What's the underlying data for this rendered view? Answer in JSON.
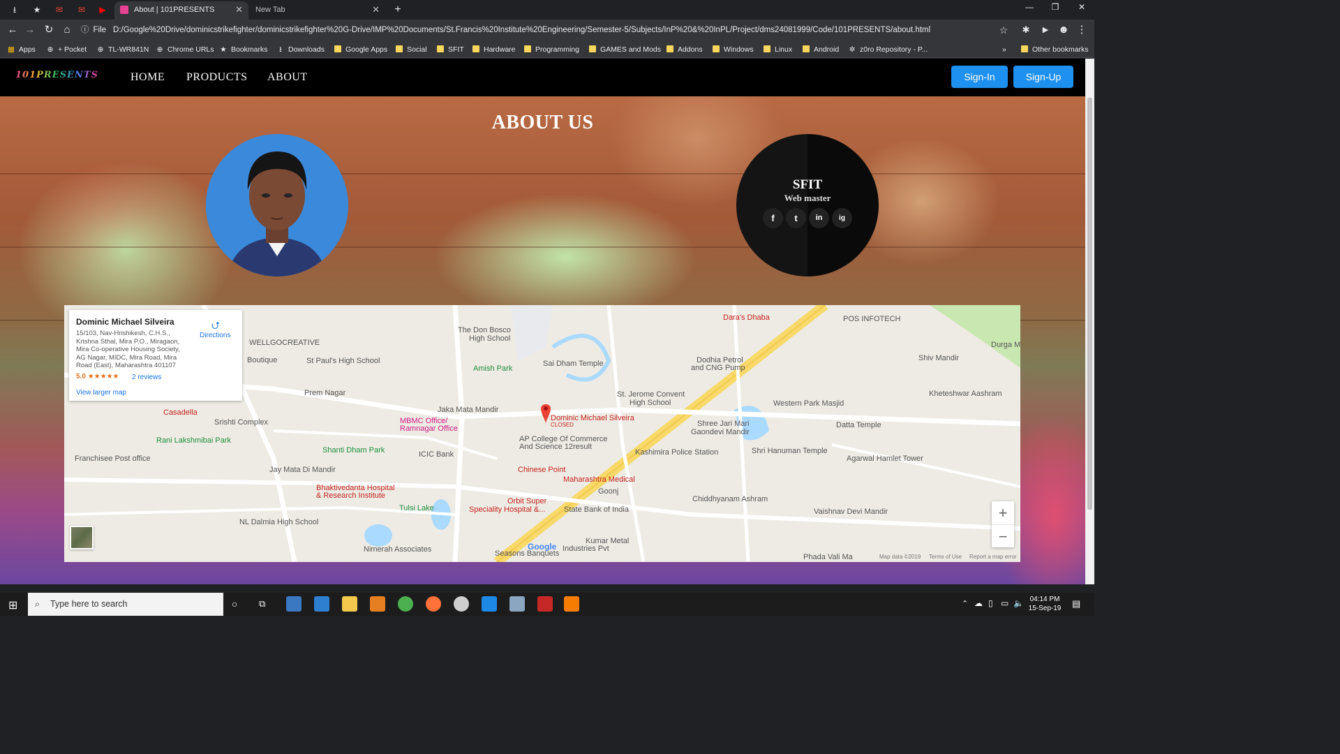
{
  "browser": {
    "tabs": [
      {
        "title": "About | 101PRESENTS",
        "active": true
      },
      {
        "title": "New Tab",
        "active": false
      }
    ],
    "address": {
      "scheme_label": "File",
      "url": "D:/Google%20Drive/dominicstrikefighter/dominicstrikefighter%20G-Drive/IMP%20Documents/St.Francis%20Institute%20Engineering/Semester-5/Subjects/InP%20&%20InPL/Project/dms24081999/Code/101PRESENTS/about.html"
    },
    "bookmarks": [
      {
        "label": "Apps",
        "icon": "apps-grid-icon"
      },
      {
        "label": "+ Pocket",
        "icon": "globe-icon"
      },
      {
        "label": "TL-WR841N",
        "icon": "globe-icon"
      },
      {
        "label": "Chrome URLs",
        "icon": "globe-icon"
      },
      {
        "label": "Bookmarks",
        "icon": "star-icon"
      },
      {
        "label": "Downloads",
        "icon": "download-icon"
      },
      {
        "label": "Google Apps",
        "icon": "folder-icon"
      },
      {
        "label": "Social",
        "icon": "folder-icon"
      },
      {
        "label": "SFIT",
        "icon": "folder-icon"
      },
      {
        "label": "Hardware",
        "icon": "folder-icon"
      },
      {
        "label": "Programming",
        "icon": "folder-icon"
      },
      {
        "label": "GAMES and Mods",
        "icon": "folder-icon"
      },
      {
        "label": "Addons",
        "icon": "folder-icon"
      },
      {
        "label": "Windows",
        "icon": "folder-icon"
      },
      {
        "label": "Linux",
        "icon": "folder-icon"
      },
      {
        "label": "Android",
        "icon": "folder-icon"
      },
      {
        "label": "z0ro Repository - P...",
        "icon": "bug-icon"
      }
    ],
    "other_bookmarks": "Other bookmarks"
  },
  "site": {
    "logo_text": "101PRESENTS",
    "nav": {
      "home": "HOME",
      "products": "PRODUCTS",
      "about": "ABOUT"
    },
    "auth": {
      "signin": "Sign-In",
      "signup": "Sign-Up"
    },
    "heading": "ABOUT US",
    "card": {
      "org": "SFIT",
      "role": "Web master",
      "social": [
        "f",
        "t",
        "in",
        "ig"
      ]
    }
  },
  "map": {
    "info": {
      "name": "Dominic Michael Silveira",
      "address": "15/103, Nav-Hrishikesh, C.H.S., Krishna Sthal, Mira P.O., Miragaon, Mira Co-operative Housing Society, AG Nagar, MIDC, Mira Road, Mira Road (East), Maharashtra 401107",
      "rating": "5.0",
      "stars": "★★★★★",
      "reviews": "2 reviews",
      "directions": "Directions",
      "larger_map": "View larger map"
    },
    "pin": {
      "name": "Dominic Michael Silveira",
      "status": "CLOSED"
    },
    "labels": [
      {
        "text": "WELLGOCREATIVE",
        "cls": ""
      },
      {
        "text": "Boutique",
        "cls": ""
      },
      {
        "text": "St Paul's High School",
        "cls": ""
      },
      {
        "text": "The Don Bosco",
        "cls": ""
      },
      {
        "text": "High School",
        "cls": ""
      },
      {
        "text": "Amish Park",
        "cls": "green"
      },
      {
        "text": "Sai Dham Temple",
        "cls": ""
      },
      {
        "text": "Dara's Dhaba",
        "cls": "red"
      },
      {
        "text": "POS INFOTECH",
        "cls": ""
      },
      {
        "text": "Durga M",
        "cls": ""
      },
      {
        "text": "Shiv Mandir",
        "cls": ""
      },
      {
        "text": "Dodhia Petrol",
        "cls": ""
      },
      {
        "text": "and CNG Pump",
        "cls": ""
      },
      {
        "text": "Prem Nagar",
        "cls": ""
      },
      {
        "text": "St. Jerome Convent",
        "cls": ""
      },
      {
        "text": "High School",
        "cls": ""
      },
      {
        "text": "Western Park Masjid",
        "cls": ""
      },
      {
        "text": "Kheteshwar Aashram",
        "cls": ""
      },
      {
        "text": "Casadella",
        "cls": "red"
      },
      {
        "text": "Jaka Mata Mandir",
        "cls": ""
      },
      {
        "text": "MBMC Office/",
        "cls": "pink"
      },
      {
        "text": "Ramnagar Office",
        "cls": "pink"
      },
      {
        "text": "Srishti Complex",
        "cls": ""
      },
      {
        "text": "Shree Jari Mari",
        "cls": ""
      },
      {
        "text": "Gaondevi Mandir",
        "cls": ""
      },
      {
        "text": "Datta Temple",
        "cls": ""
      },
      {
        "text": "Rani Lakshmibai Park",
        "cls": "green"
      },
      {
        "text": "AP College Of Commerce",
        "cls": ""
      },
      {
        "text": "And Science 12result",
        "cls": ""
      },
      {
        "text": "Shanti Dham Park",
        "cls": "green"
      },
      {
        "text": "ICIC Bank",
        "cls": ""
      },
      {
        "text": "Kashimira Police Station",
        "cls": ""
      },
      {
        "text": "Shri Hanuman Temple",
        "cls": ""
      },
      {
        "text": "Franchisee Post office",
        "cls": ""
      },
      {
        "text": "Agarwal Hamlet Tower",
        "cls": ""
      },
      {
        "text": "Jay Mata Di Mandir",
        "cls": ""
      },
      {
        "text": "Chinese Point",
        "cls": "red"
      },
      {
        "text": "Maharashtra Medical",
        "cls": "red"
      },
      {
        "text": "Bhaktivedanta Hospital",
        "cls": "red"
      },
      {
        "text": "& Research Institute",
        "cls": "red"
      },
      {
        "text": "Goonj",
        "cls": ""
      },
      {
        "text": "Chiddhyanam Ashram",
        "cls": ""
      },
      {
        "text": "Orbit Super",
        "cls": "red"
      },
      {
        "text": "Speciality Hospital &...",
        "cls": "red"
      },
      {
        "text": "Tulsi Lake",
        "cls": "green"
      },
      {
        "text": "State Bank of India",
        "cls": ""
      },
      {
        "text": "Vaishnav Devi Mandir",
        "cls": ""
      },
      {
        "text": "NL Dalmia High School",
        "cls": ""
      },
      {
        "text": "Kumar Metal",
        "cls": ""
      },
      {
        "text": "Industries Pvt",
        "cls": ""
      },
      {
        "text": "Nimerah Associates",
        "cls": ""
      },
      {
        "text": "Seasons Banquets",
        "cls": ""
      },
      {
        "text": "Phada Vali Ma",
        "cls": ""
      }
    ],
    "footer": {
      "data": "Map data ©2019",
      "terms": "Terms of Use",
      "report": "Report a map error"
    },
    "google": "Google"
  },
  "taskbar": {
    "search_placeholder": "Type here to search",
    "time": "04:14 PM",
    "date": "15-Sep-19"
  }
}
